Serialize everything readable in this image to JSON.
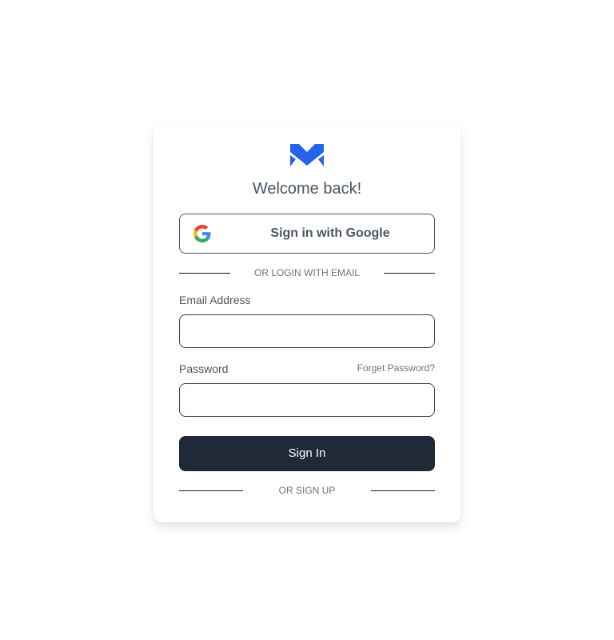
{
  "brand": {
    "logo_icon": "m-logo-icon",
    "accent_color": "#2563eb"
  },
  "header": {
    "title": "Welcome back!"
  },
  "google": {
    "label": "Sign in with Google",
    "icon": "google-icon"
  },
  "divider_email": {
    "label": "OR LOGIN WITH EMAIL"
  },
  "form": {
    "email_label": "Email Address",
    "email_value": "",
    "password_label": "Password",
    "password_value": "",
    "forget_password": "Forget Password?",
    "submit_label": "Sign In",
    "submit_color": "#1f2937"
  },
  "divider_signup": {
    "label": "OR SIGN UP"
  }
}
